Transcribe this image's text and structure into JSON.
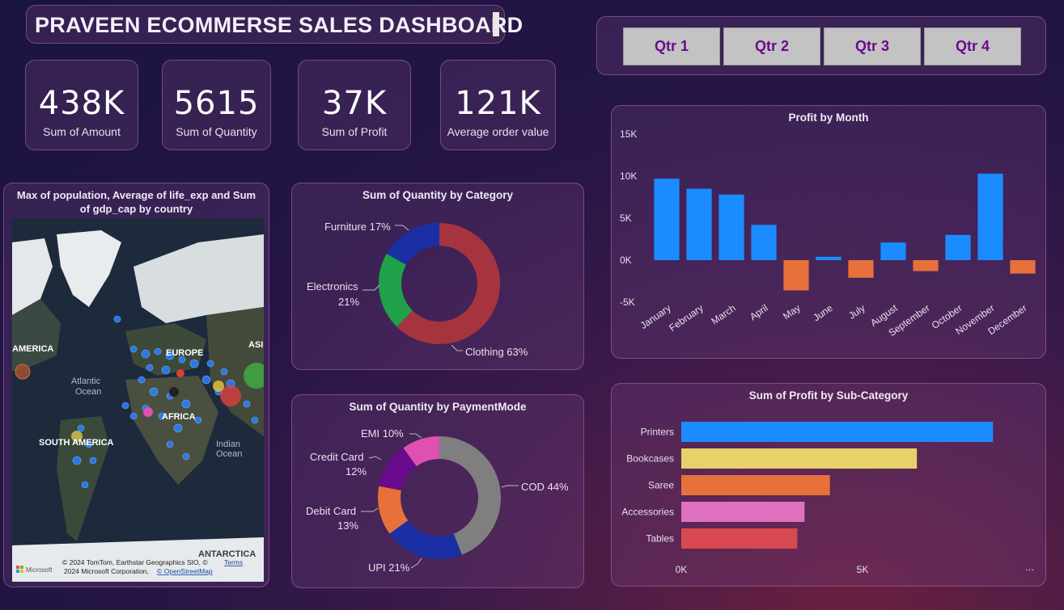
{
  "header": {
    "title": "PRAVEEN ECOMMERSE SALES DASHBOARD"
  },
  "slicer": {
    "buttons": [
      "Qtr 1",
      "Qtr 2",
      "Qtr 3",
      "Qtr 4"
    ]
  },
  "kpis": [
    {
      "value": "438K",
      "label": "Sum of Amount"
    },
    {
      "value": "5615",
      "label": "Sum of Quantity"
    },
    {
      "value": "37K",
      "label": "Sum of Profit"
    },
    {
      "value": "121K",
      "label": "Average order value"
    }
  ],
  "map": {
    "title_line1": "Max of population, Average of life_exp and Sum",
    "title_line2": "of gdp_cap by country",
    "labels": [
      "AMERICA",
      "EUROPE",
      "ASI",
      "Atlantic",
      "Ocean",
      "AFRICA",
      "SOUTH AMERICA",
      "Indian",
      "Ocean",
      "ANTARCTICA"
    ],
    "attribution_line1": "© 2024 TomTom, Earthstar Geographics SIO, ©",
    "attribution_terms": "Terms",
    "attribution_line2": "2024 Microsoft Corporation,",
    "attribution_osm": "© OpenStreetMap",
    "brand": "Microsoft"
  },
  "colors": {
    "accent_purple": "#6a0a8c",
    "bar_blue": "#1a8cff",
    "bar_orange": "#e8703a"
  },
  "chart_data": [
    {
      "type": "bar",
      "title": "Profit by Month",
      "categories": [
        "January",
        "February",
        "March",
        "April",
        "May",
        "June",
        "July",
        "August",
        "September",
        "October",
        "November",
        "December"
      ],
      "values": [
        9700,
        8500,
        7800,
        4200,
        -3600,
        400,
        -2100,
        2100,
        -1300,
        3000,
        10300,
        -1600
      ],
      "ylim": [
        -5000,
        15000
      ],
      "yticks": [
        "15K",
        "10K",
        "5K",
        "0K",
        "-5K"
      ],
      "ytick_values": [
        15000,
        10000,
        5000,
        0,
        -5000
      ],
      "colors": {
        "positive": "#1a8cff",
        "negative": "#e8703a"
      }
    },
    {
      "type": "pie",
      "title": "Sum of Quantity by Category",
      "labels": [
        "Clothing",
        "Electronics",
        "Furniture"
      ],
      "display_labels": [
        "Clothing 63%",
        "Electronics",
        "21%",
        "Furniture 17%"
      ],
      "values": [
        63,
        21,
        17
      ],
      "colors": [
        "#a6343f",
        "#1fa24a",
        "#1a2fa3"
      ]
    },
    {
      "type": "pie",
      "title": "Sum of Quantity by PaymentMode",
      "labels": [
        "COD",
        "UPI",
        "Debit Card",
        "Credit Card",
        "EMI"
      ],
      "display_labels": [
        "COD 44%",
        "UPI 21%",
        "Debit Card",
        "13%",
        "Credit Card",
        "12%",
        "EMI 10%"
      ],
      "values": [
        44,
        21,
        13,
        12,
        10
      ],
      "colors": [
        "#7f7f7f",
        "#1a2fa3",
        "#e8703a",
        "#6a0a8c",
        "#e050b0"
      ]
    },
    {
      "type": "bar",
      "title": "Sum of Profit by Sub-Category",
      "orientation": "horizontal",
      "categories": [
        "Printers",
        "Bookcases",
        "Saree",
        "Accessories",
        "Tables"
      ],
      "values": [
        8600,
        6500,
        4100,
        3400,
        3200
      ],
      "colors": [
        "#1a8cff",
        "#e8d06a",
        "#e8703a",
        "#e070c0",
        "#d84850"
      ],
      "xticks": [
        "0K",
        "5K"
      ],
      "xtick_values": [
        0,
        5000
      ],
      "more": "..."
    }
  ]
}
